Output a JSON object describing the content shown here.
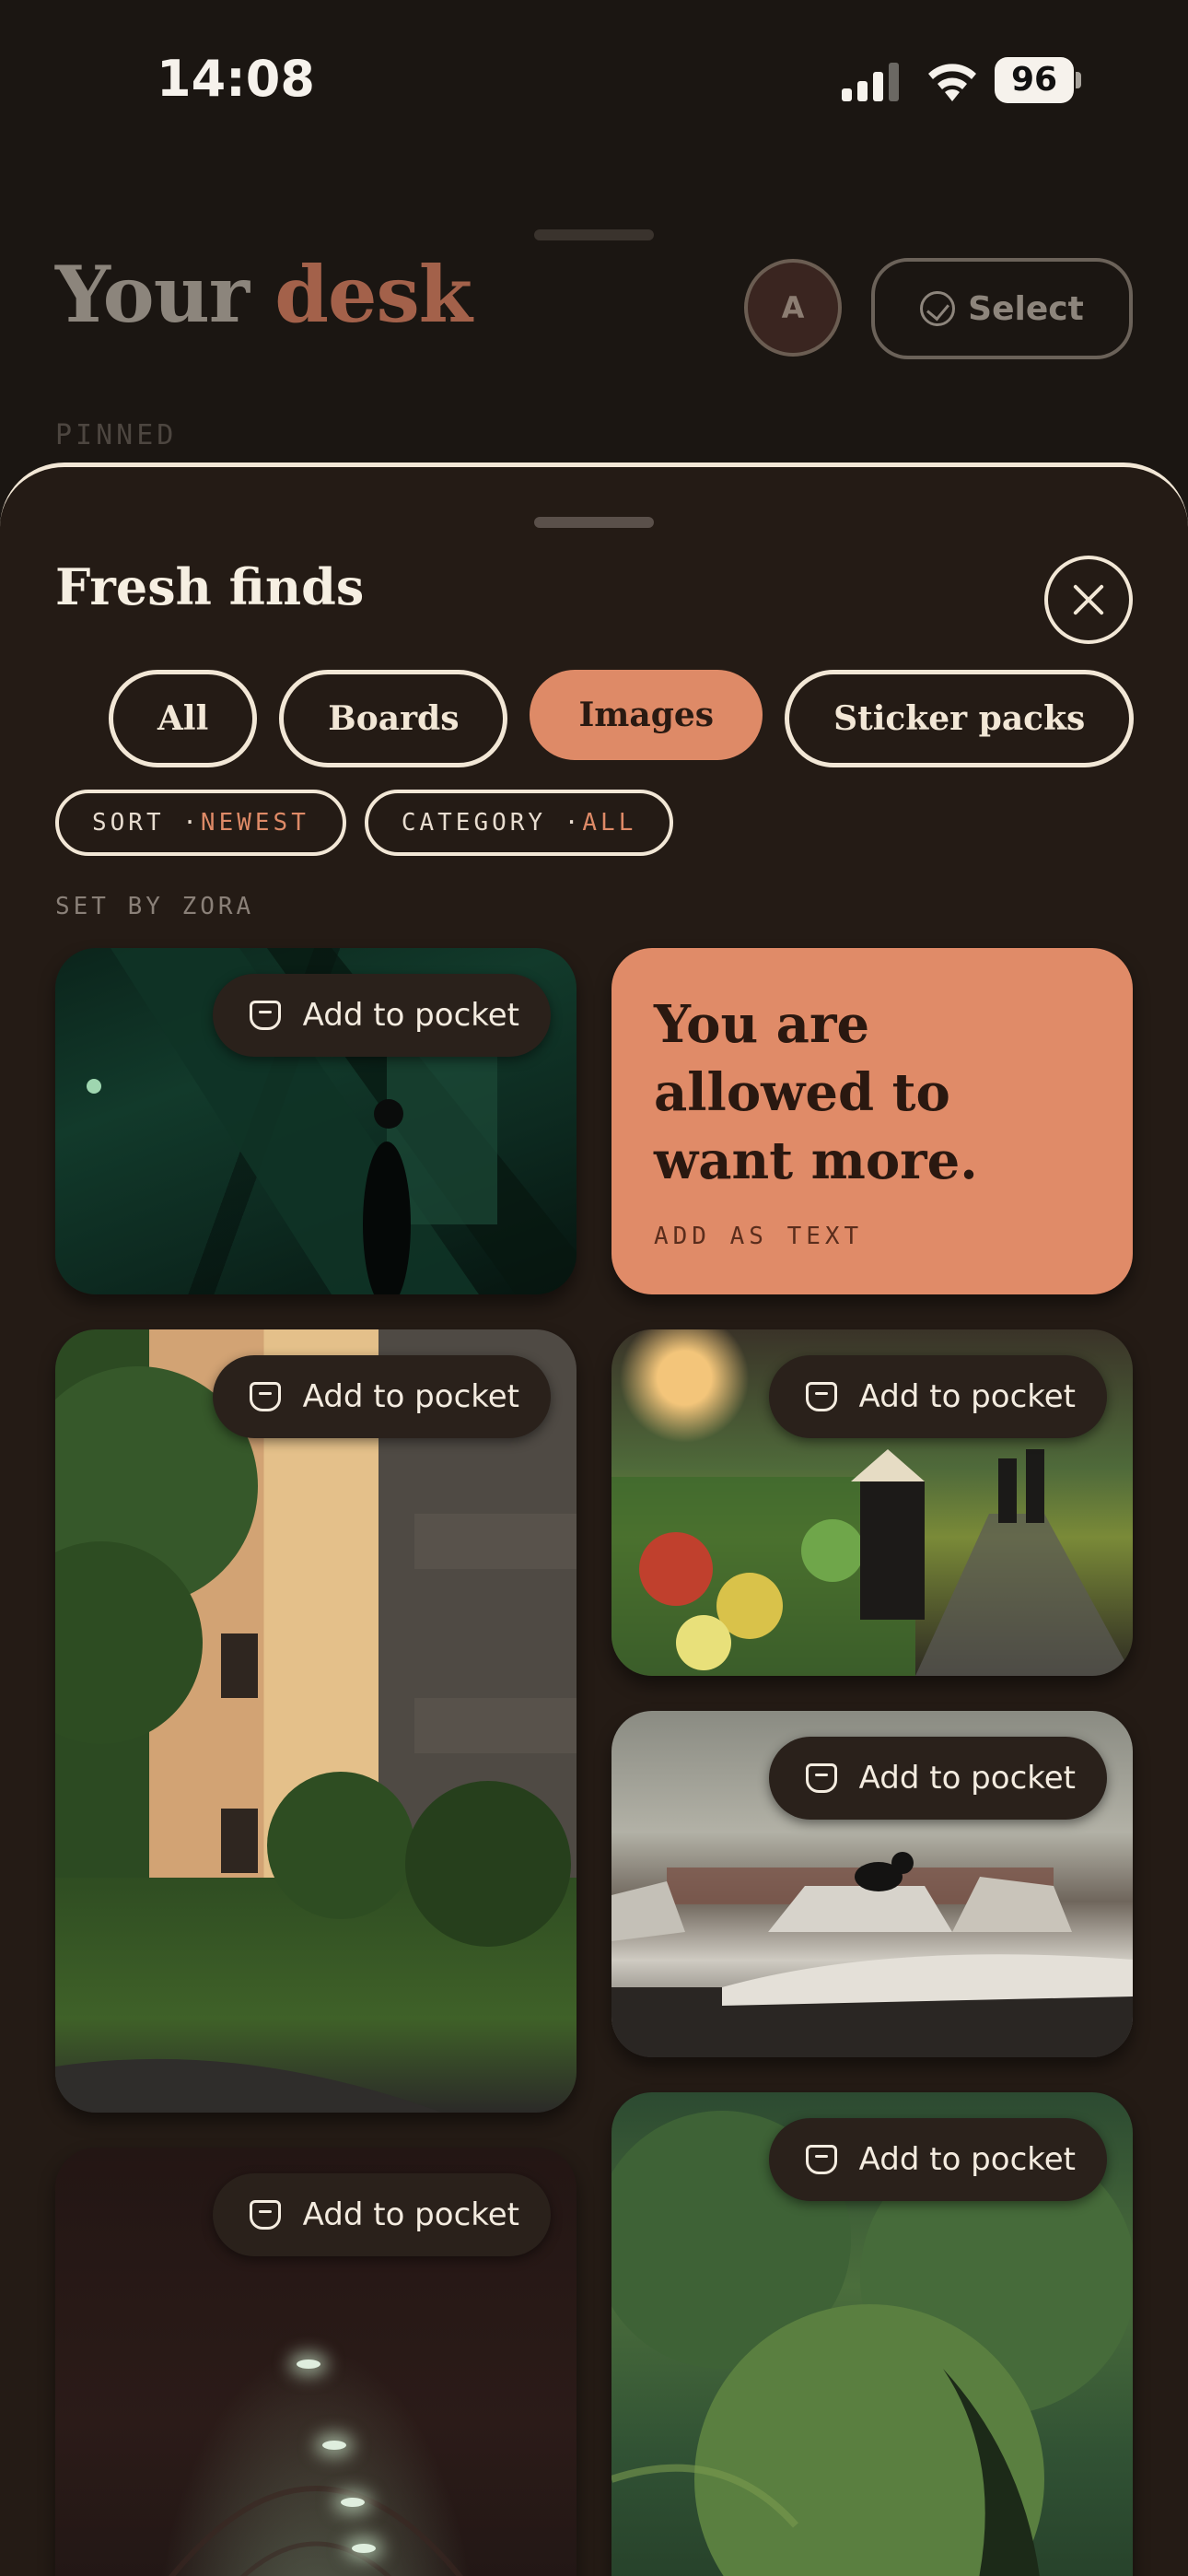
{
  "status_bar": {
    "time": "14:08",
    "battery": "96"
  },
  "desk": {
    "title_word1": "Your",
    "title_word2": "desk",
    "avatar_initial": "A",
    "select_label": "Select",
    "pinned_label": "PINNED"
  },
  "sheet": {
    "title": "Fresh finds",
    "tabs": [
      {
        "label": "All",
        "active": false
      },
      {
        "label": "Boards",
        "active": false
      },
      {
        "label": "Images",
        "active": true
      },
      {
        "label": "Sticker packs",
        "active": false
      }
    ],
    "filters": {
      "sort_key": "SORT · ",
      "sort_value": "NEWEST",
      "category_key": "CATEGORY · ",
      "category_value": "ALL"
    },
    "section_label": "SET BY ZORA",
    "pocket_label": "Add to pocket",
    "quote": {
      "text": "You are allowed to want more.",
      "action": "ADD AS TEXT"
    }
  },
  "colors": {
    "accent": "#de8a67",
    "sheet_background": "#241b15",
    "outline": "#f2e7d6"
  }
}
